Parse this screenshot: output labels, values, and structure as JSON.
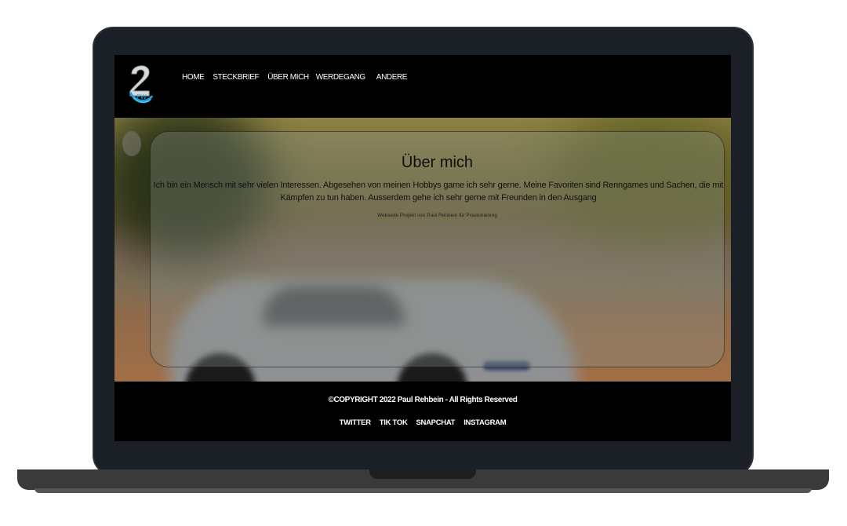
{
  "nav": {
    "items": [
      {
        "label": "HOME"
      },
      {
        "label": "STECKBRIEF"
      },
      {
        "label": "ÜBER MICH"
      },
      {
        "label": "WERDEGANG"
      },
      {
        "label": "ANDERE"
      }
    ]
  },
  "main": {
    "title": "Über mich",
    "text": "Ich bin ein Mensch mit sehr vielen Interessen. Abgesehen von meinen Hobbys game ich sehr gerne. Meine Favoriten sind Renngames und Sachen, die mit Kämpfen zu tun haben. Ausserdem gehe ich sehr gerne mit Freunden in den Ausgang",
    "credit": "Webseite Projekt von Paul Rehbein für Praxistraining"
  },
  "footer": {
    "copyright": "©COPYRIGHT 2022 Paul Rehbein - All Rights Reserved",
    "social": [
      {
        "label": "TWITTER"
      },
      {
        "label": "TIK TOK"
      },
      {
        "label": "SNAPCHAT"
      },
      {
        "label": "INSTAGRAM"
      }
    ]
  },
  "colors": {
    "frame": "#1b2026",
    "screen_bg": "#000000",
    "card_bg": "rgba(140,150,140,0.33)"
  },
  "icons": {
    "logo": "logo-2paul"
  }
}
